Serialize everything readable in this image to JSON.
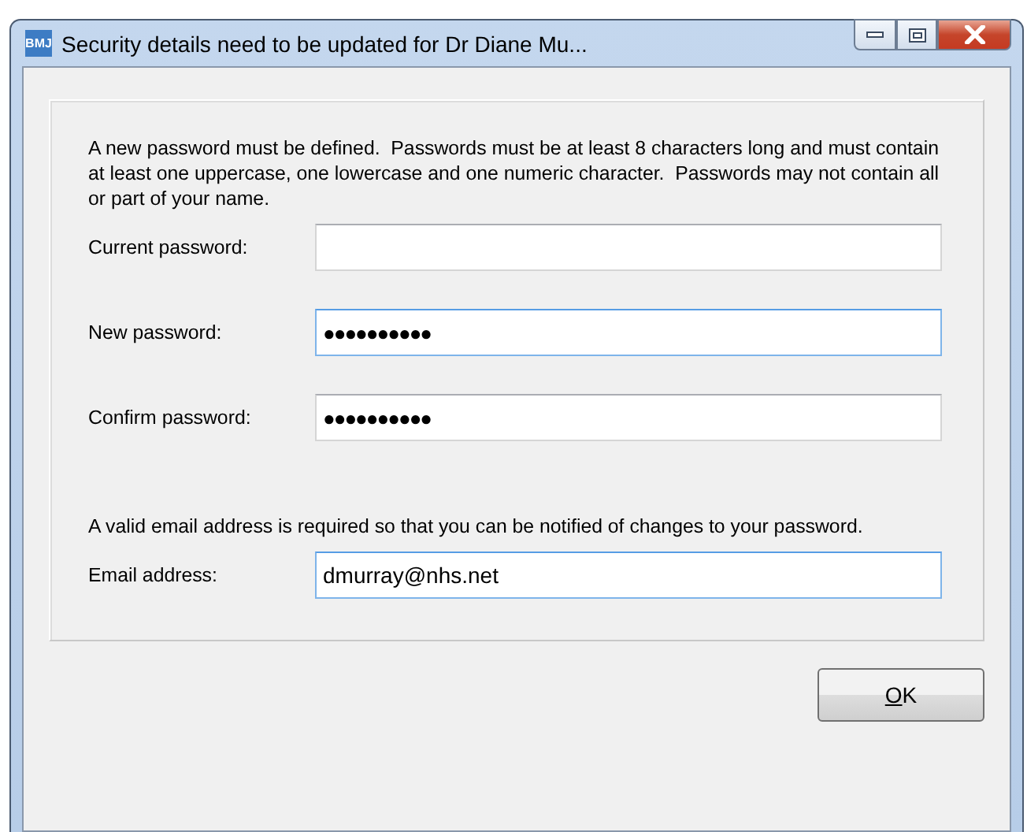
{
  "window": {
    "title": "Security details need to be updated for Dr Diane Mu...",
    "icon_text": "BMJ"
  },
  "intro": "A new password must be defined.  Passwords must be at least 8 characters long and must contain at least one uppercase, one lowercase and one numeric character.  Passwords may not contain all or part of your name.",
  "password_fields": [
    {
      "label": "Current password:",
      "focused": false
    },
    {
      "label": "New password:",
      "value": "●●●●●●●●●●",
      "focused": true
    },
    {
      "label": "Confirm password:",
      "value": "●●●●●●●●●●",
      "focused": false
    }
  ],
  "email_note": "A valid email address is required so that you can be notified of changes to your password.",
  "email_field": {
    "label": "Email address:",
    "value": "dmurray@nhs.net",
    "focused": true
  },
  "buttons": [
    {
      "label": "OK"
    }
  ]
}
